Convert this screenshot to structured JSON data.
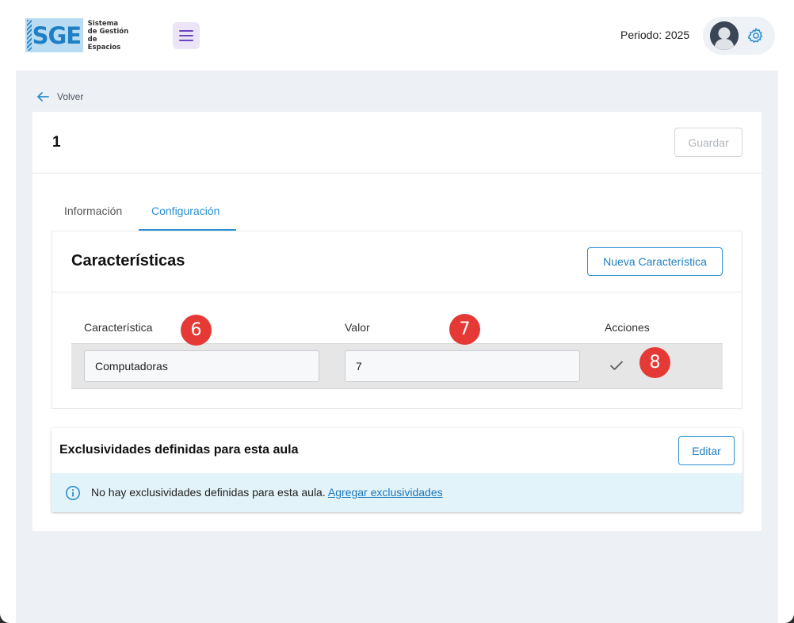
{
  "header": {
    "logo_mark": "SGE",
    "logo_text": [
      "Sistema",
      "de Gestión",
      "de Espacios"
    ],
    "periodo": "Periodo: 2025"
  },
  "nav": {
    "back_label": "Volver"
  },
  "record": {
    "title": "1",
    "save_label": "Guardar"
  },
  "tabs": [
    {
      "label": "Información",
      "active": false
    },
    {
      "label": "Configuración",
      "active": true
    }
  ],
  "caracteristicas": {
    "title": "Características",
    "new_button": "Nueva Característica",
    "columns": [
      "Característica",
      "Valor",
      "Acciones"
    ],
    "rows": [
      {
        "caracteristica": "Computadoras",
        "valor": "7"
      }
    ]
  },
  "annotations": [
    "6",
    "7",
    "8"
  ],
  "exclusividades": {
    "title": "Exclusividades definidas para esta aula",
    "edit_button": "Editar",
    "empty_message": "No hay exclusividades definidas para esta aula.",
    "add_link": "Agregar exclusividades"
  },
  "colors": {
    "accent": "#2b8fd0",
    "badge": "#e53935",
    "info_bg": "#e3f3fa",
    "menu_bg": "#ebe5f7"
  }
}
